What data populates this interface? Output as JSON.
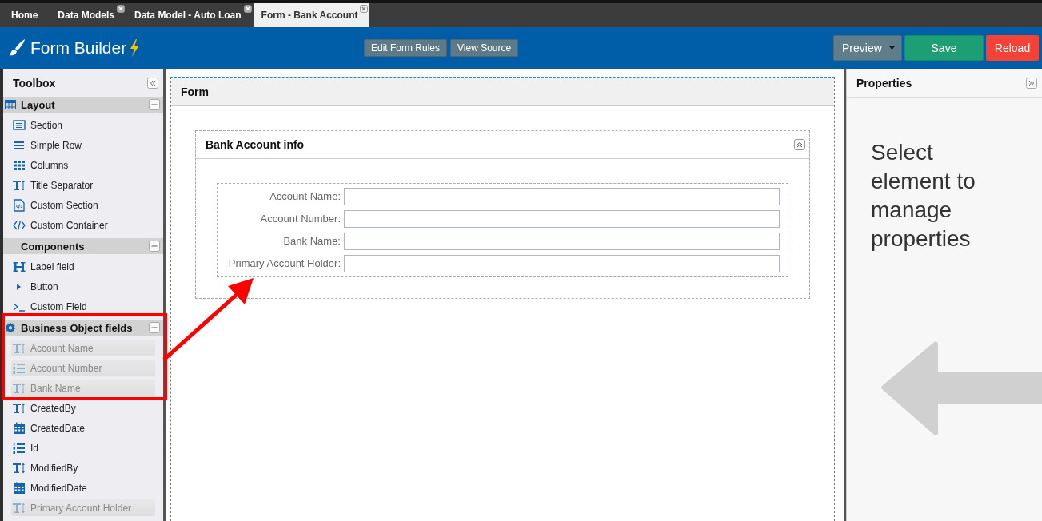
{
  "tabs": [
    {
      "label": "Home",
      "closable": false,
      "selected": false
    },
    {
      "label": "Data Models",
      "closable": true,
      "selected": false
    },
    {
      "label": "Data Model - Auto Loan",
      "closable": true,
      "selected": false
    },
    {
      "label": "Form - Bank Account",
      "closable": true,
      "selected": true
    }
  ],
  "header": {
    "title": "Form Builder",
    "actions": [
      "Edit Form Rules",
      "View Source"
    ],
    "buttons": [
      {
        "label": "Preview",
        "kind": "dropdown"
      },
      {
        "label": "Save",
        "kind": "primary"
      },
      {
        "label": "Reload",
        "kind": "danger"
      }
    ]
  },
  "toolbox": {
    "title": "Toolbox",
    "groups": [
      {
        "label": "Layout",
        "kind": "layout",
        "expanded": true,
        "items": [
          {
            "label": "Section",
            "kind": "section",
            "disabled": false
          },
          {
            "label": "Simple Row",
            "kind": "row",
            "disabled": false
          },
          {
            "label": "Columns",
            "kind": "columns",
            "disabled": false
          },
          {
            "label": "Title Separator",
            "kind": "text",
            "disabled": false
          },
          {
            "label": "Custom Section",
            "kind": "custom-section",
            "disabled": false
          },
          {
            "label": "Custom Container",
            "kind": "code",
            "disabled": false
          }
        ]
      },
      {
        "label": "Components",
        "kind": "plain",
        "expanded": true,
        "items": [
          {
            "label": "Label field",
            "kind": "label",
            "disabled": false
          },
          {
            "label": "Button",
            "kind": "button",
            "disabled": false
          },
          {
            "label": "Custom Field",
            "kind": "terminal",
            "disabled": false
          }
        ]
      },
      {
        "label": "Business Object fields",
        "kind": "fields",
        "expanded": true,
        "items": [
          {
            "label": "Account Name",
            "kind": "text",
            "disabled": true
          },
          {
            "label": "Account Number",
            "kind": "number",
            "disabled": true
          },
          {
            "label": "Bank Name",
            "kind": "text",
            "disabled": true
          },
          {
            "label": "CreatedBy",
            "kind": "text",
            "disabled": false
          },
          {
            "label": "CreatedDate",
            "kind": "date",
            "disabled": false
          },
          {
            "label": "Id",
            "kind": "number",
            "disabled": false
          },
          {
            "label": "ModifiedBy",
            "kind": "text",
            "disabled": false
          },
          {
            "label": "ModifiedDate",
            "kind": "date",
            "disabled": false
          },
          {
            "label": "Primary Account Holder",
            "kind": "text",
            "disabled": true
          }
        ]
      }
    ]
  },
  "form": {
    "title": "Form",
    "section": {
      "title": "Bank Account info",
      "fields": [
        {
          "label": "Account Name:"
        },
        {
          "label": "Account Number:"
        },
        {
          "label": "Bank Name:"
        },
        {
          "label": "Primary Account Holder:"
        }
      ]
    }
  },
  "properties": {
    "title": "Properties",
    "message": "Select element to manage properties"
  }
}
